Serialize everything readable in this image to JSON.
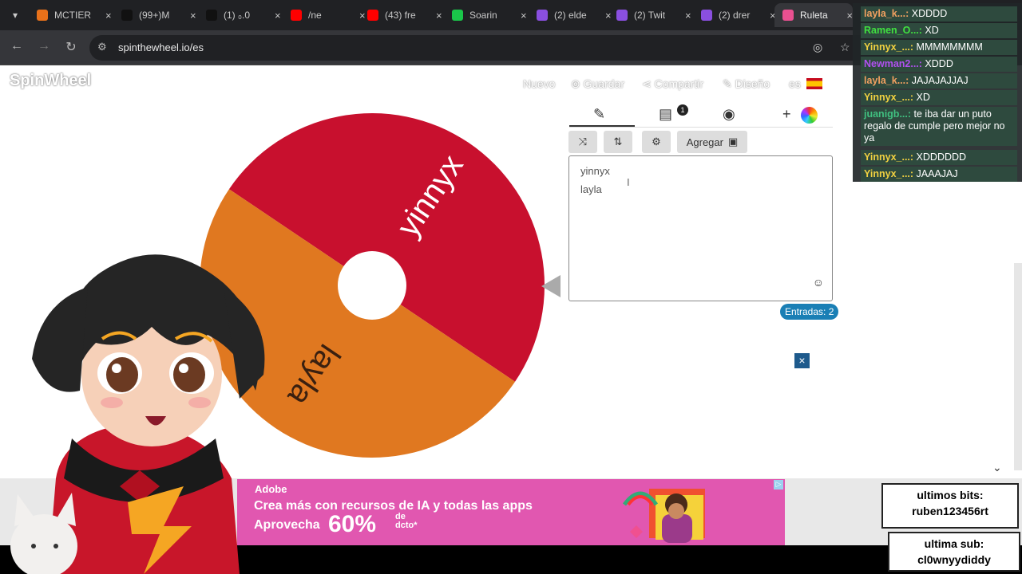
{
  "browser": {
    "tabs": [
      {
        "title": "MCTIER",
        "color": "#e8711a"
      },
      {
        "title": "(99+)M",
        "color": "#111111"
      },
      {
        "title": "(1) ₀.0",
        "color": "#111111"
      },
      {
        "title": "/ne",
        "color": "#ff0000"
      },
      {
        "title": "(43) fre",
        "color": "#ff0000"
      },
      {
        "title": "Soarin",
        "color": "#1ac64a"
      },
      {
        "title": "(2) elde",
        "color": "#8a4fe0"
      },
      {
        "title": "(2) Twit",
        "color": "#8a4fe0"
      },
      {
        "title": "(2) drer",
        "color": "#8a4fe0"
      },
      {
        "title": "Ruleta",
        "color": "#e95090"
      }
    ],
    "url": "spinthewheel.io/es"
  },
  "header": {
    "logo": "SpinWheel",
    "nav": [
      "Nuevo",
      "Guardar",
      "Compartir",
      "Diseño"
    ],
    "lang": "es"
  },
  "wheel": {
    "segments": [
      {
        "label": "yinnyx",
        "color": "#c8102e"
      },
      {
        "label": "layla",
        "color": "#e07820"
      }
    ]
  },
  "panel": {
    "add_label": "Agregar",
    "entries": [
      "yinnyx",
      "layla"
    ],
    "notification_count": "1",
    "entries_count": "Entradas: 2"
  },
  "chat": [
    {
      "user": "layla_k...:",
      "text": "XDDDD",
      "color": "#f0a060"
    },
    {
      "user": "Ramen_O...:",
      "text": "XD",
      "color": "#40e040"
    },
    {
      "user": "Yinnyx_...:",
      "text": "MMMMMMMM",
      "color": "#f0d040"
    },
    {
      "user": "Newman2...:",
      "text": "XDDD",
      "color": "#b050f0"
    },
    {
      "user": "layla_k...:",
      "text": "JAJAJAJJAJ",
      "color": "#f0a060"
    },
    {
      "user": "Yinnyx_...:",
      "text": "XD",
      "color": "#f0d040"
    },
    {
      "user": "juanigb...:",
      "text": "te iba dar un puto regalo de cumple pero mejor no ya",
      "color": "#40c080"
    },
    {
      "user": "Yinnyx_...:",
      "text": "XDDDDDD",
      "color": "#f0d040"
    },
    {
      "user": "Yinnyx_...:",
      "text": "JAAAJAJ",
      "color": "#f0d040"
    }
  ],
  "ad": {
    "brand": "Adobe",
    "line1": "Crea más con recursos de IA y todas las apps",
    "line2": "Aprovecha",
    "percent": "60%",
    "suffix_top": "de",
    "suffix_bottom": "dcto*"
  },
  "stream": {
    "bits_title": "ultimos bits:",
    "bits_user": "ruben123456rt",
    "sub_title": "ultima sub:",
    "sub_user": "cl0wnyydiddy"
  }
}
